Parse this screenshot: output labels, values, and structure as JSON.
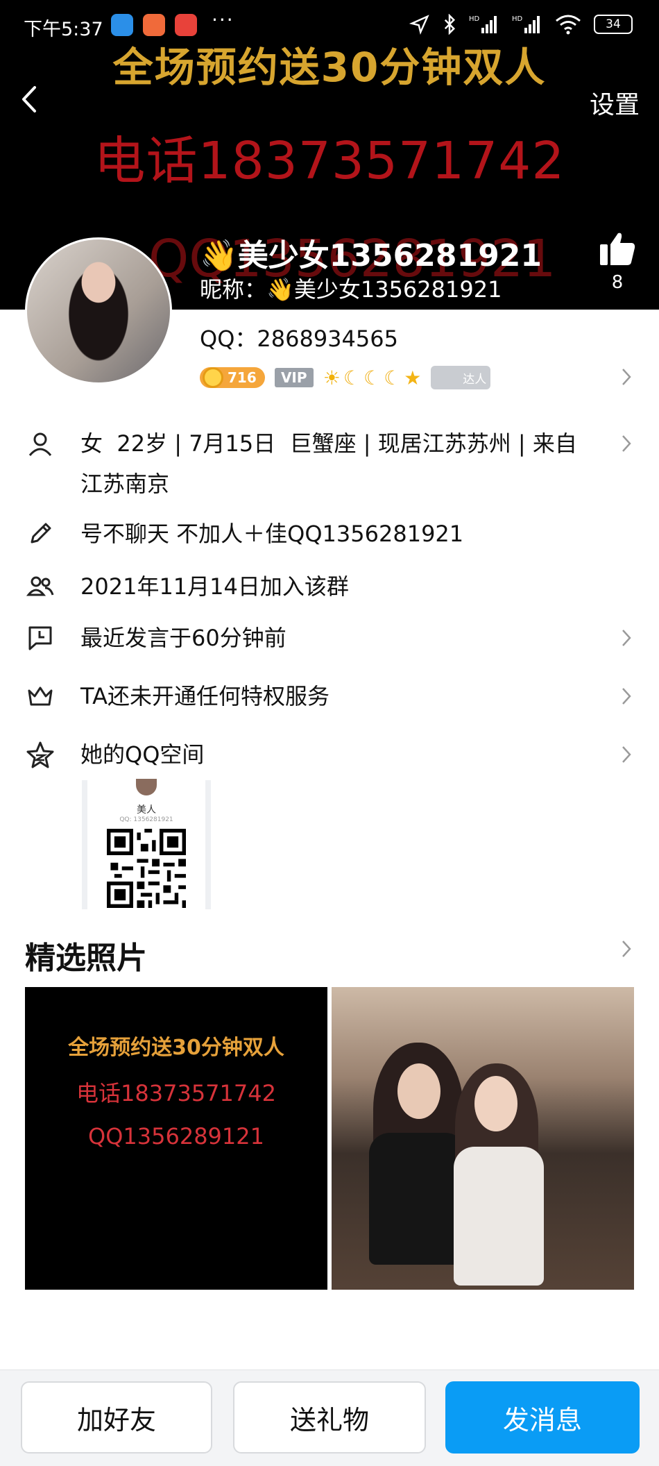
{
  "status_bar": {
    "time": "下午5:37",
    "dots": "···",
    "battery": "34"
  },
  "cover": {
    "banner_line1": "全场预约送30分钟双人",
    "banner_line2": "电话18373571742",
    "banner_line3": "QQ1356281921"
  },
  "header": {
    "settings_label": "设置",
    "nickname": "👋美少女1356281921",
    "nickname_label": "昵称：👋美少女1356281921",
    "like_count": "8"
  },
  "profile": {
    "qq_label": "QQ：2868934565",
    "level": "716",
    "vip_label": "VIP",
    "talent_label": "达人"
  },
  "details": {
    "basic_info": "女  22岁 | 7月15日  巨蟹座 | 现居江苏苏州 | 来自",
    "basic_info_line2": "江苏南京",
    "signature": "号不聊天 不加人＋佳QQ1356281921",
    "join_date": "2021年11月14日加入该群",
    "last_active": "最近发言于60分钟前",
    "privilege": "TA还未开通任何特权服务",
    "qzone": "她的QQ空间"
  },
  "qr_card": {
    "name": "美人",
    "sub": "QQ: 1356281921"
  },
  "photos": {
    "section_title": "精选照片",
    "photo1_line1": "全场预约送30分钟双人",
    "photo1_line2": "电话18373571742",
    "photo1_line3": "QQ1356289121"
  },
  "actions": {
    "add_friend": "加好友",
    "send_gift": "送礼物",
    "send_message": "发消息"
  },
  "colors": {
    "primary_button": "#0a9cf5",
    "banner_gold": "#d7a52f",
    "banner_red": "#b3141a"
  }
}
